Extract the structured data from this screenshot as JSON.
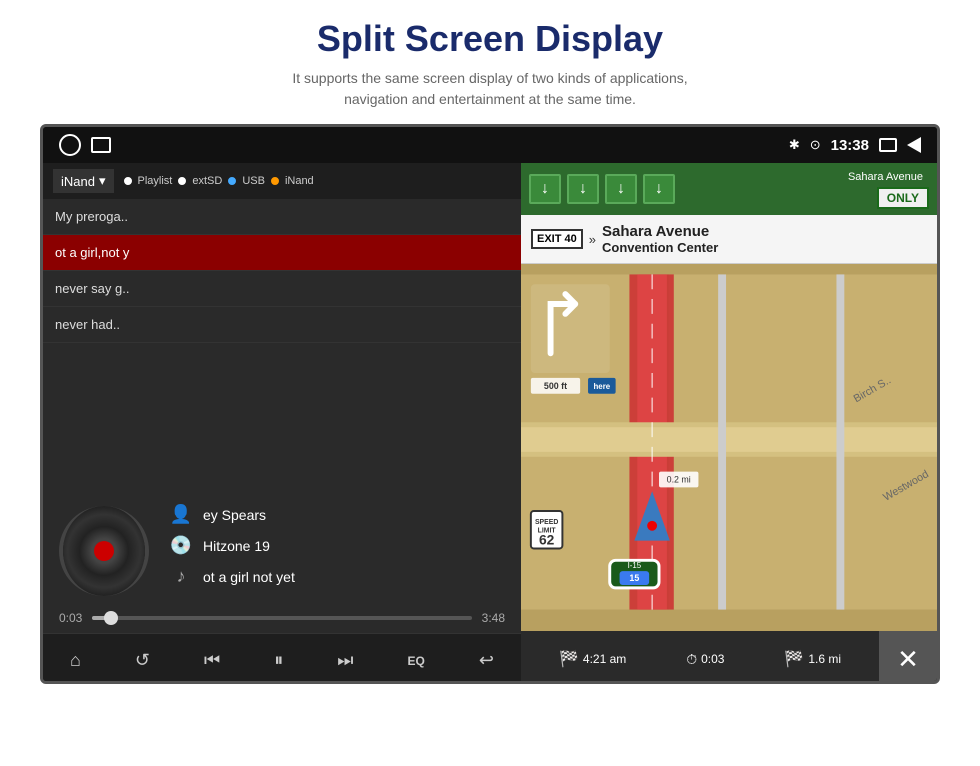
{
  "header": {
    "title": "Split Screen Display",
    "subtitle": "It supports the same screen display of two kinds of applications,\nnavigation and entertainment at the same time."
  },
  "statusBar": {
    "time": "13:38",
    "bluetooth": "✱",
    "location": "⊙"
  },
  "music": {
    "source": "iNand",
    "sourceOptions": [
      "Playlist",
      "extSD",
      "USB",
      "iNand"
    ],
    "playlist": [
      {
        "label": "My preroga..",
        "active": false
      },
      {
        "label": "ot a girl,not y",
        "active": true
      },
      {
        "label": "never say g..",
        "active": false
      },
      {
        "label": "never had..",
        "active": false
      }
    ],
    "artist": "ey Spears",
    "album": "Hitzone 19",
    "track": "ot a girl not yet",
    "timeElapsed": "0:03",
    "timeTotal": "3:48",
    "controls": {
      "home": "⌂",
      "repeat": "↺",
      "prev": "⏮",
      "playPause": "⏸",
      "next": "⏭",
      "eq": "EQ",
      "back": "↩"
    }
  },
  "navigation": {
    "topSigns": {
      "arrows": [
        "↓",
        "↓",
        "↓",
        "↓"
      ],
      "only": "ONLY",
      "street": "Sahara Avenue"
    },
    "exitBar": {
      "exitNum": "EXIT 40",
      "arrow": "»",
      "mainStreet": "Sahara Avenue",
      "subStreet": "Convention Center"
    },
    "speedLimit": "62",
    "routeNum": "I-15",
    "distance": "0.2 mi",
    "distToTurn": "500 ft",
    "bottomBar": {
      "eta": "4:21 am",
      "duration": "0:03",
      "distance": "1.6 mi",
      "close": "✕"
    }
  }
}
